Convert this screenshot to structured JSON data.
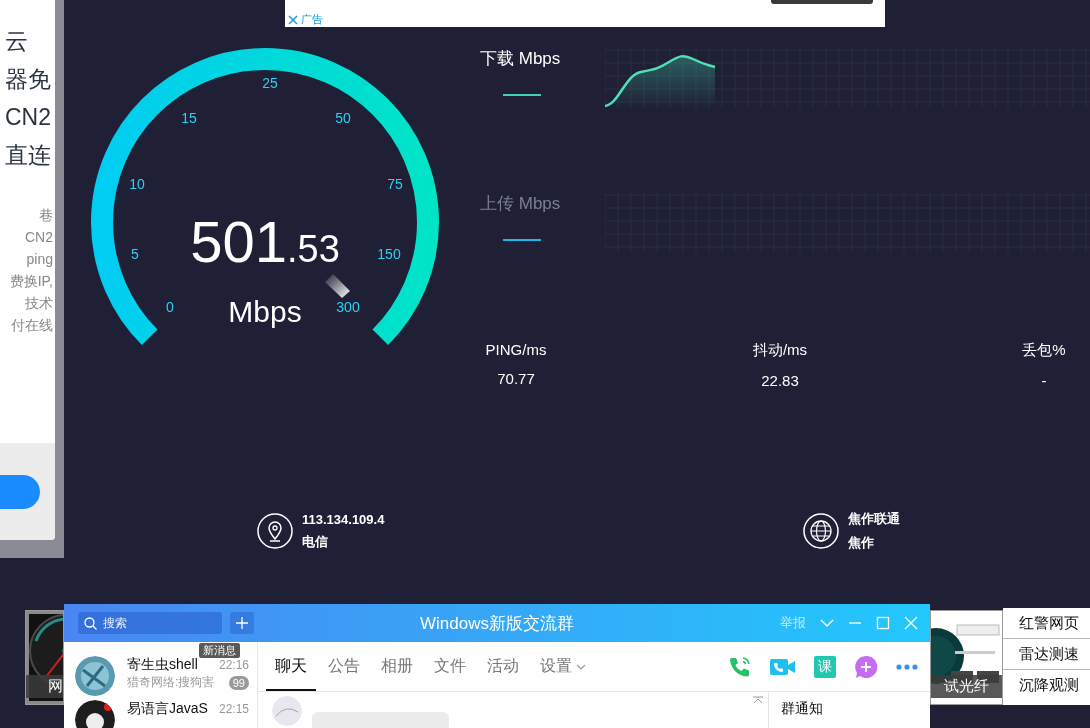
{
  "left_panel": {
    "headline": [
      "云",
      "器免",
      "CN2",
      "直连"
    ],
    "body": [
      "巷",
      "CN2",
      "ping",
      "费换IP,",
      "技术",
      "付在线"
    ]
  },
  "ad_strip": {
    "label": "广告"
  },
  "gauge": {
    "ticks": [
      "0",
      "5",
      "10",
      "15",
      "25",
      "50",
      "75",
      "150",
      "300"
    ],
    "integer": "501",
    "fraction": ".53",
    "unit": "Mbps"
  },
  "download": {
    "label": "下载 Mbps",
    "active": true
  },
  "upload": {
    "label": "上传 Mbps",
    "active": false
  },
  "stats": [
    {
      "label": "PING/ms",
      "value": "70.77"
    },
    {
      "label": "抖动/ms",
      "value": "22.83"
    },
    {
      "label": "丢包%",
      "value": "-"
    }
  ],
  "server": {
    "ip": "113.134.109.4",
    "isp": "电信",
    "node": "焦作联通",
    "city": "焦作"
  },
  "thumbnails": [
    {
      "kind": "picture",
      "caption": "网"
    },
    {
      "kind": "picture",
      "caption": "试光纤"
    }
  ],
  "side_links": [
    "红警网页",
    "雷达测速",
    "沉降观测"
  ],
  "chat_window": {
    "search_placeholder": "搜索",
    "title": "Windows新版交流群",
    "report": "举报",
    "tooltip": "新消息",
    "conversations": [
      {
        "name": "寄生虫shell",
        "time": "22:16",
        "preview": "猎奇网络:搜狗害",
        "badge": "99"
      },
      {
        "name": "易语言JavaS",
        "time": "22:15"
      }
    ],
    "tabs": [
      {
        "label": "聊天",
        "selected": true,
        "menu": false
      },
      {
        "label": "公告",
        "selected": false,
        "menu": false
      },
      {
        "label": "相册",
        "selected": false,
        "menu": false
      },
      {
        "label": "文件",
        "selected": false,
        "menu": false
      },
      {
        "label": "活动",
        "selected": false,
        "menu": false
      },
      {
        "label": "设置",
        "selected": false,
        "menu": true
      }
    ],
    "toolbar": [
      {
        "kind": "call"
      },
      {
        "kind": "video"
      },
      {
        "kind": "course",
        "label": "课"
      },
      {
        "kind": "app"
      },
      {
        "kind": "more"
      }
    ],
    "notice_title": "群通知"
  }
}
